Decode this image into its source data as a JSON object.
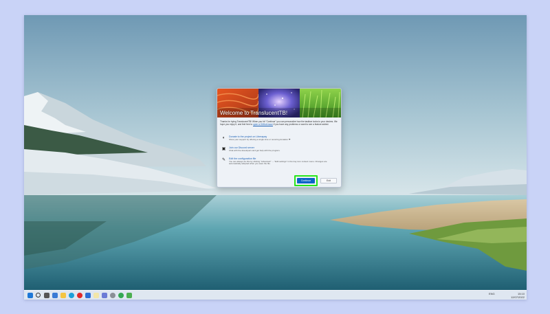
{
  "dialog": {
    "title": "Welcome to TranslucentTB!",
    "intro_before": "Thanks for trying TranslucentTB! When you hit \"Continue\" you can personalize how the taskbar looks to your desires. We hope you enjoy it, and feel free to ",
    "intro_link": "open a GitHub issue",
    "intro_after": " if you have any problems or want to see a feature added.",
    "items": [
      {
        "title": "Donate to the project on Liberapay",
        "description": "Show your support by offering a single time or recurring donation ❤"
      },
      {
        "title": "Join our Discord server",
        "description": "Chat with the developers and get help with the program."
      },
      {
        "title": "Edit the configuration file",
        "description": "You can always do this by clicking \"Advanced\" → \"Edit settings\" in the tray icon context menu. Changes are automatically adopted when you save the file."
      }
    ],
    "continue_label": "Continue",
    "exit_label": "Exit"
  },
  "taskbar": {
    "icons": [
      "start-icon",
      "search-icon",
      "task-view-icon",
      "widgets-icon",
      "file-explorer-icon",
      "edge-icon",
      "opera-icon",
      "todo-icon",
      "notes-icon",
      "store-icon",
      "settings-icon",
      "chrome-icon",
      "translucenttb-icon"
    ],
    "time": "15:10",
    "date": "12/07/2022",
    "language": "ENG"
  },
  "colors": {
    "accent": "#0a64c8",
    "highlight": "#27e61a",
    "link": "#1a5fb4"
  }
}
